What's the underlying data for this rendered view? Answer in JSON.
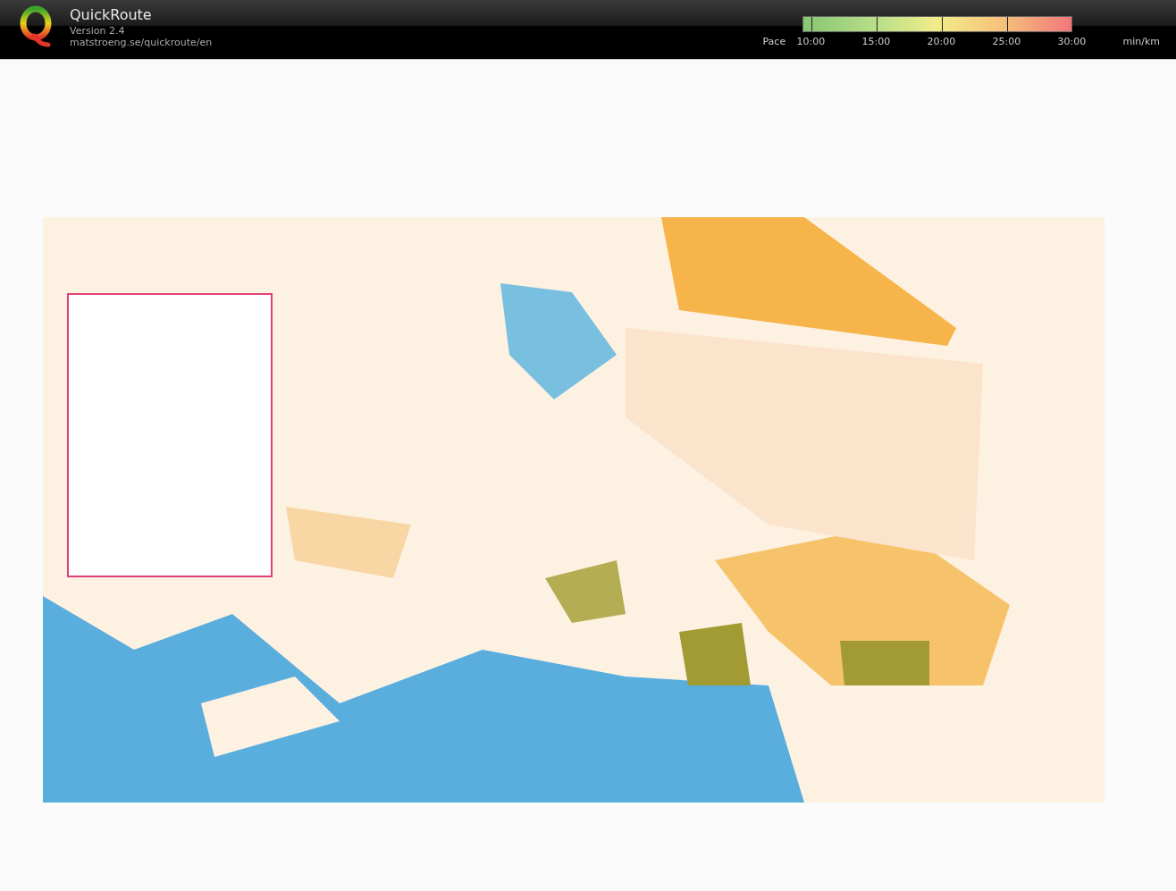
{
  "header": {
    "title": "QuickRoute",
    "version": "Version 2.4",
    "url": "matstroeng.se/quickroute/en"
  },
  "pace_legend": {
    "label": "Pace",
    "ticks": [
      "10:00",
      "15:00",
      "20:00",
      "25:00",
      "30:00"
    ],
    "unit": "min/km"
  }
}
